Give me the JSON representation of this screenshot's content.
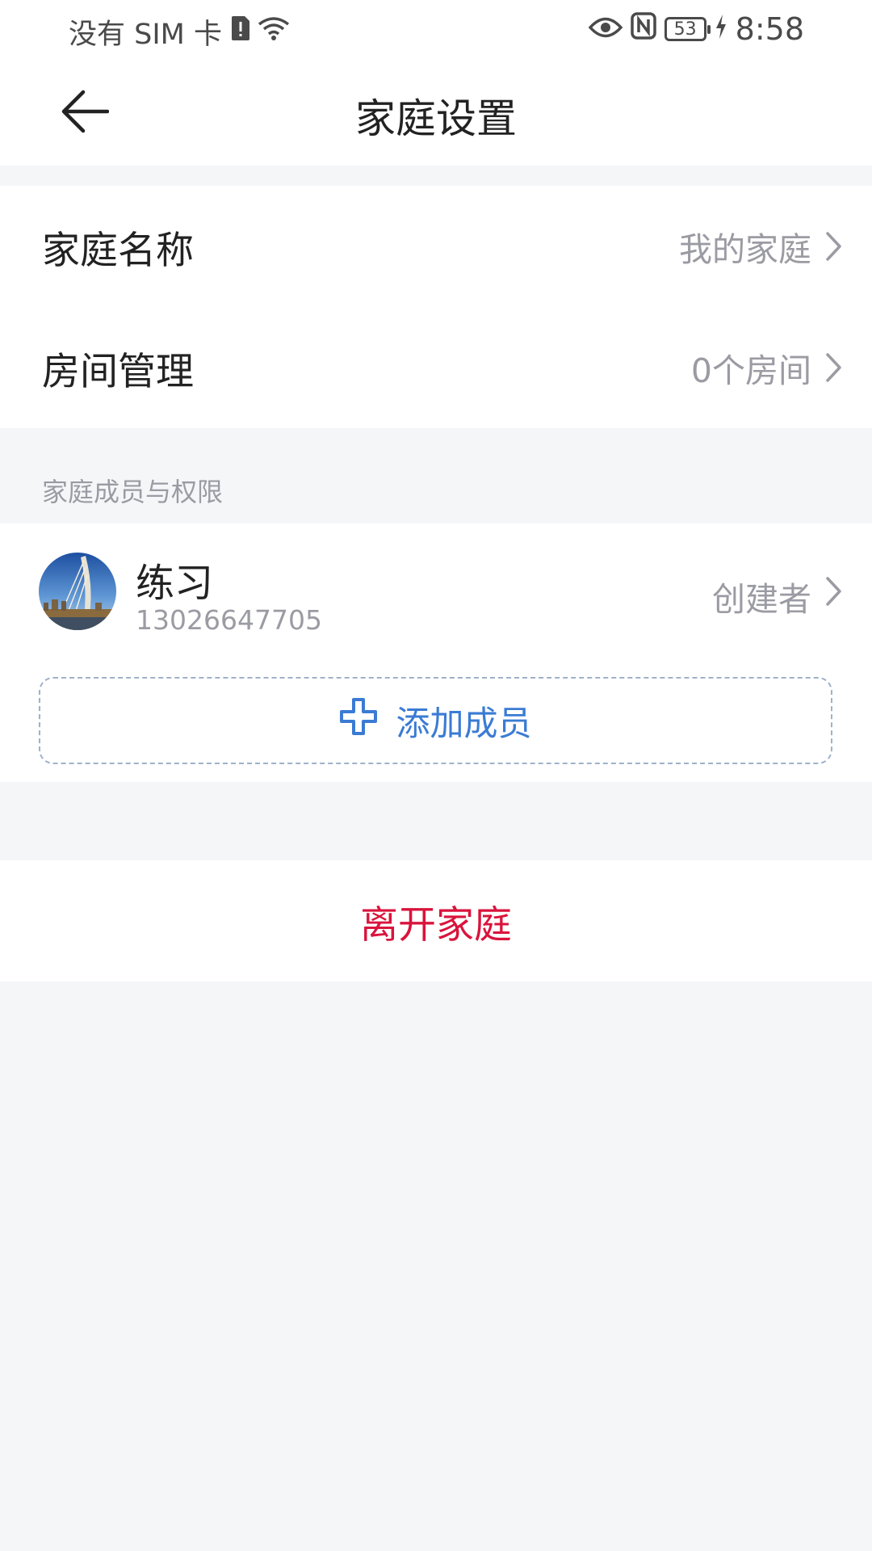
{
  "status_bar": {
    "carrier": "没有 SIM 卡",
    "battery_level": "53",
    "time": "8:58",
    "icons": [
      "sim-alert-icon",
      "wifi-icon",
      "eye-icon",
      "nfc-icon",
      "battery-icon",
      "charging-icon"
    ]
  },
  "header": {
    "title": "家庭设置",
    "back_icon": "arrow-left-icon"
  },
  "settings": {
    "family_name": {
      "label": "家庭名称",
      "value": "我的家庭"
    },
    "room_management": {
      "label": "房间管理",
      "value": "0个房间"
    }
  },
  "members_section": {
    "title": "家庭成员与权限",
    "members": [
      {
        "name": "练习",
        "phone": "13026647705",
        "role": "创建者"
      }
    ],
    "add_member_label": "添加成员"
  },
  "leave_family_label": "离开家庭",
  "colors": {
    "background": "#f5f6f8",
    "card": "#ffffff",
    "secondary_text": "#9b9ba3",
    "accent_blue": "#3b7bd4",
    "danger_red": "#d9143c"
  }
}
